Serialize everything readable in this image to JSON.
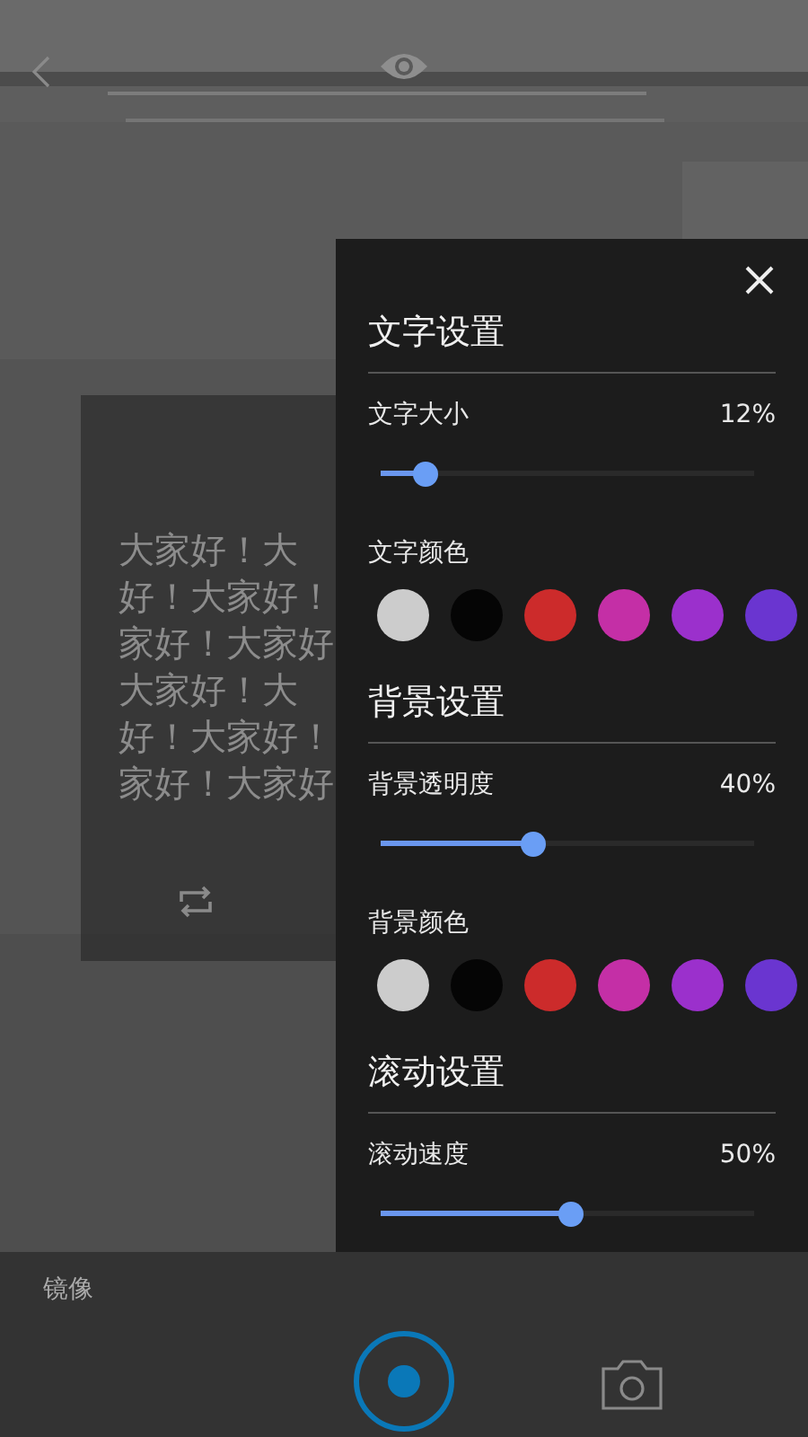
{
  "prompter": {
    "lines": [
      "大家好！大",
      "好！大家好！",
      "家好！大家好",
      "大家好！大",
      "好！大家好！",
      "家好！大家好"
    ]
  },
  "settings_panel": {
    "sections": [
      {
        "title": "文字设置",
        "items": [
          {
            "kind": "slider",
            "label": "文字大小",
            "value": "12%",
            "level": 0.12
          },
          {
            "kind": "swatches",
            "label": "文字颜色",
            "colors": [
              {
                "color": "#cccccc"
              },
              {
                "color": "#050505"
              },
              {
                "color": "#cc2b2b"
              },
              {
                "color": "#c42fa6"
              },
              {
                "color": "#9b30cc"
              },
              {
                "color": "#6a35d0"
              }
            ]
          }
        ]
      },
      {
        "title": "背景设置",
        "items": [
          {
            "kind": "slider",
            "label": "背景透明度",
            "value": "40%",
            "level": 0.41
          },
          {
            "kind": "swatches",
            "label": "背景颜色",
            "colors": [
              {
                "color": "#cccccc"
              },
              {
                "color": "#050505"
              },
              {
                "color": "#cc2b2b"
              },
              {
                "color": "#c42fa6"
              },
              {
                "color": "#9b30cc"
              },
              {
                "color": "#6a35d0"
              }
            ]
          }
        ]
      },
      {
        "title": "滚动设置",
        "items": [
          {
            "kind": "slider",
            "label": "滚动速度",
            "value": "50%",
            "level": 0.51
          }
        ]
      }
    ]
  },
  "bottom_bar": {
    "mirror_label": "镜像"
  }
}
